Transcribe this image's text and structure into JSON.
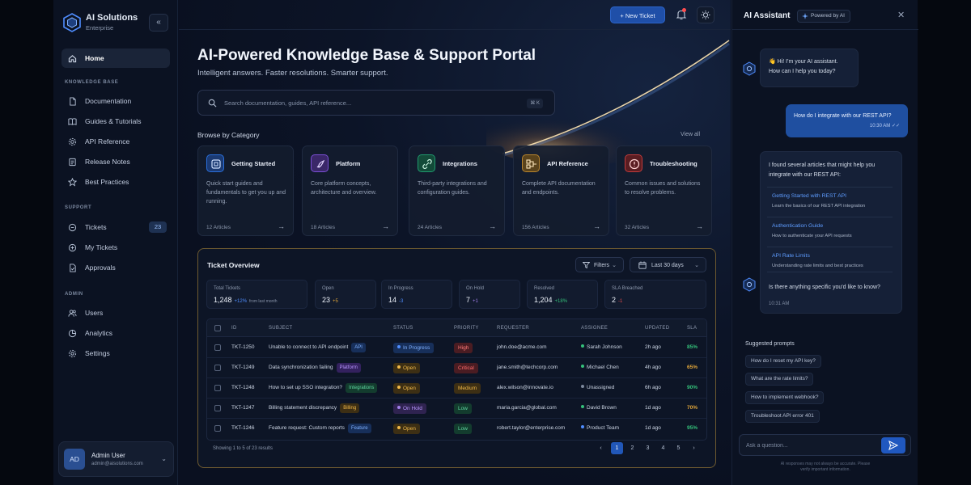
{
  "brand": {
    "name": "AI Solutions",
    "sub": "Enterprise",
    "collapse": "«"
  },
  "sidebar": {
    "home": "Home",
    "sections": {
      "knowledge": "KNOWLEDGE BASE",
      "support": "SUPPORT",
      "admin": "ADMIN"
    },
    "knowledge_items": [
      "Documentation",
      "Guides & Tutorials",
      "API Reference",
      "Release Notes",
      "Best Practices"
    ],
    "support_items": [
      "Tickets",
      "My Tickets",
      "Approvals"
    ],
    "tickets_badge": "23",
    "admin_items": [
      "Users",
      "Analytics",
      "Settings"
    ]
  },
  "user": {
    "initials": "AD",
    "name": "Admin User",
    "email": "admin@aisolutions.com"
  },
  "topbar": {
    "new_ticket": "+ New Ticket"
  },
  "hero": {
    "title": "AI-Powered Knowledge Base & Support Portal",
    "subtitle": "Intelligent answers. Faster resolutions. Smarter support."
  },
  "search": {
    "placeholder": "Search documentation, guides, API reference...",
    "shortcut": "⌘ K"
  },
  "browse": {
    "title": "Browse by Category",
    "view_all": "View all",
    "categories": [
      {
        "title": "Getting Started",
        "desc": "Quick start guides and fundamentals to get you up and running.",
        "count": "12 Articles",
        "color": "#2a6fdb"
      },
      {
        "title": "Platform",
        "desc": "Core platform concepts, architecture and overview.",
        "count": "18 Articles",
        "color": "#7b4fd6"
      },
      {
        "title": "Integrations",
        "desc": "Third-party integrations and configuration guides.",
        "count": "24 Articles",
        "color": "#1f9a6e"
      },
      {
        "title": "API Reference",
        "desc": "Complete API documentation and endpoints.",
        "count": "156 Articles",
        "color": "#b9852d"
      },
      {
        "title": "Troubleshooting",
        "desc": "Common issues and solutions to resolve problems.",
        "count": "32 Articles",
        "color": "#c23b3b"
      }
    ]
  },
  "tickets": {
    "title": "Ticket Overview",
    "filters": "Filters",
    "range": "Last 30 days",
    "stats": [
      {
        "label": "Total Tickets",
        "value": "1,248",
        "delta": "+12%",
        "note": "from last month",
        "delta_color": "#4f8dff"
      },
      {
        "label": "Open",
        "value": "23",
        "delta": "+5",
        "note": "",
        "delta_color": "#e0a53a"
      },
      {
        "label": "In Progress",
        "value": "14",
        "delta": "-3",
        "note": "",
        "delta_color": "#4f8dff"
      },
      {
        "label": "On Hold",
        "value": "7",
        "delta": "+1",
        "note": "",
        "delta_color": "#a07ee8"
      },
      {
        "label": "Resolved",
        "value": "1,204",
        "delta": "+18%",
        "note": "",
        "delta_color": "#34c07a"
      },
      {
        "label": "SLA Breached",
        "value": "2",
        "delta": "-1",
        "note": "",
        "delta_color": "#e24d4d"
      }
    ],
    "columns": [
      "ID",
      "SUBJECT",
      "STATUS",
      "PRIORITY",
      "REQUESTER",
      "ASSIGNEE",
      "UPDATED",
      "SLA"
    ],
    "rows": [
      {
        "id": "TKT-1250",
        "subject": "Unable to connect to API endpoint",
        "tag": "API",
        "status": "In Progress",
        "priority": "High",
        "requester": "john.doe@acme.com",
        "assignee": "Sarah Johnson",
        "updated": "2h ago",
        "sla": "85%"
      },
      {
        "id": "TKT-1249",
        "subject": "Data synchronization failing",
        "tag": "Platform",
        "status": "Open",
        "priority": "Critical",
        "requester": "jane.smith@techcorp.com",
        "assignee": "Michael Chen",
        "updated": "4h ago",
        "sla": "65%"
      },
      {
        "id": "TKT-1248",
        "subject": "How to set up SSO integration?",
        "tag": "Integrations",
        "status": "Open",
        "priority": "Medium",
        "requester": "alex.wilson@innovate.io",
        "assignee": "Unassigned",
        "updated": "6h ago",
        "sla": "90%"
      },
      {
        "id": "TKT-1247",
        "subject": "Billing statement discrepancy",
        "tag": "Billing",
        "status": "On Hold",
        "priority": "Low",
        "requester": "maria.garcia@global.com",
        "assignee": "David Brown",
        "updated": "1d ago",
        "sla": "70%"
      },
      {
        "id": "TKT-1246",
        "subject": "Feature request: Custom reports",
        "tag": "Feature",
        "status": "Open",
        "priority": "Low",
        "requester": "robert.taylor@enterprise.com",
        "assignee": "Product Team",
        "updated": "1d ago",
        "sla": "95%"
      }
    ],
    "showing": "Showing 1 to 5 of 23 results",
    "pages": [
      "‹",
      "1",
      "2",
      "3",
      "4",
      "5",
      "›"
    ]
  },
  "assistant": {
    "title": "AI Assistant",
    "powered": "Powered by AI",
    "close": "✕",
    "greeting_1": "👋 Hi! I'm your AI assistant.",
    "greeting_2": "How can I help you today?",
    "user_msg": "How do I integrate with our REST API?",
    "user_time": "10:30 AM ✓✓",
    "reply_intro_1": "I found several articles that might help you",
    "reply_intro_2": "integrate with our REST API:",
    "links": [
      {
        "title": "Getting Started with REST API",
        "desc": "Learn the basics of our REST API integration"
      },
      {
        "title": "Authentication Guide",
        "desc": "How to authenticate your API requests"
      },
      {
        "title": "API Rate Limits",
        "desc": "Understanding rate limits and best practices"
      }
    ],
    "reply_outro": "Is there anything specific you'd like to know?",
    "reply_time": "10:31 AM",
    "suggested_title": "Suggested prompts",
    "suggestions": [
      "How do I reset my API key?",
      "What are the rate limits?",
      "How to implement webhook?",
      "Troubleshoot API error 401"
    ],
    "ask_placeholder": "Ask a question...",
    "disclaimer_1": "AI responses may not always be accurate. Please",
    "disclaimer_2": "verify important information."
  }
}
